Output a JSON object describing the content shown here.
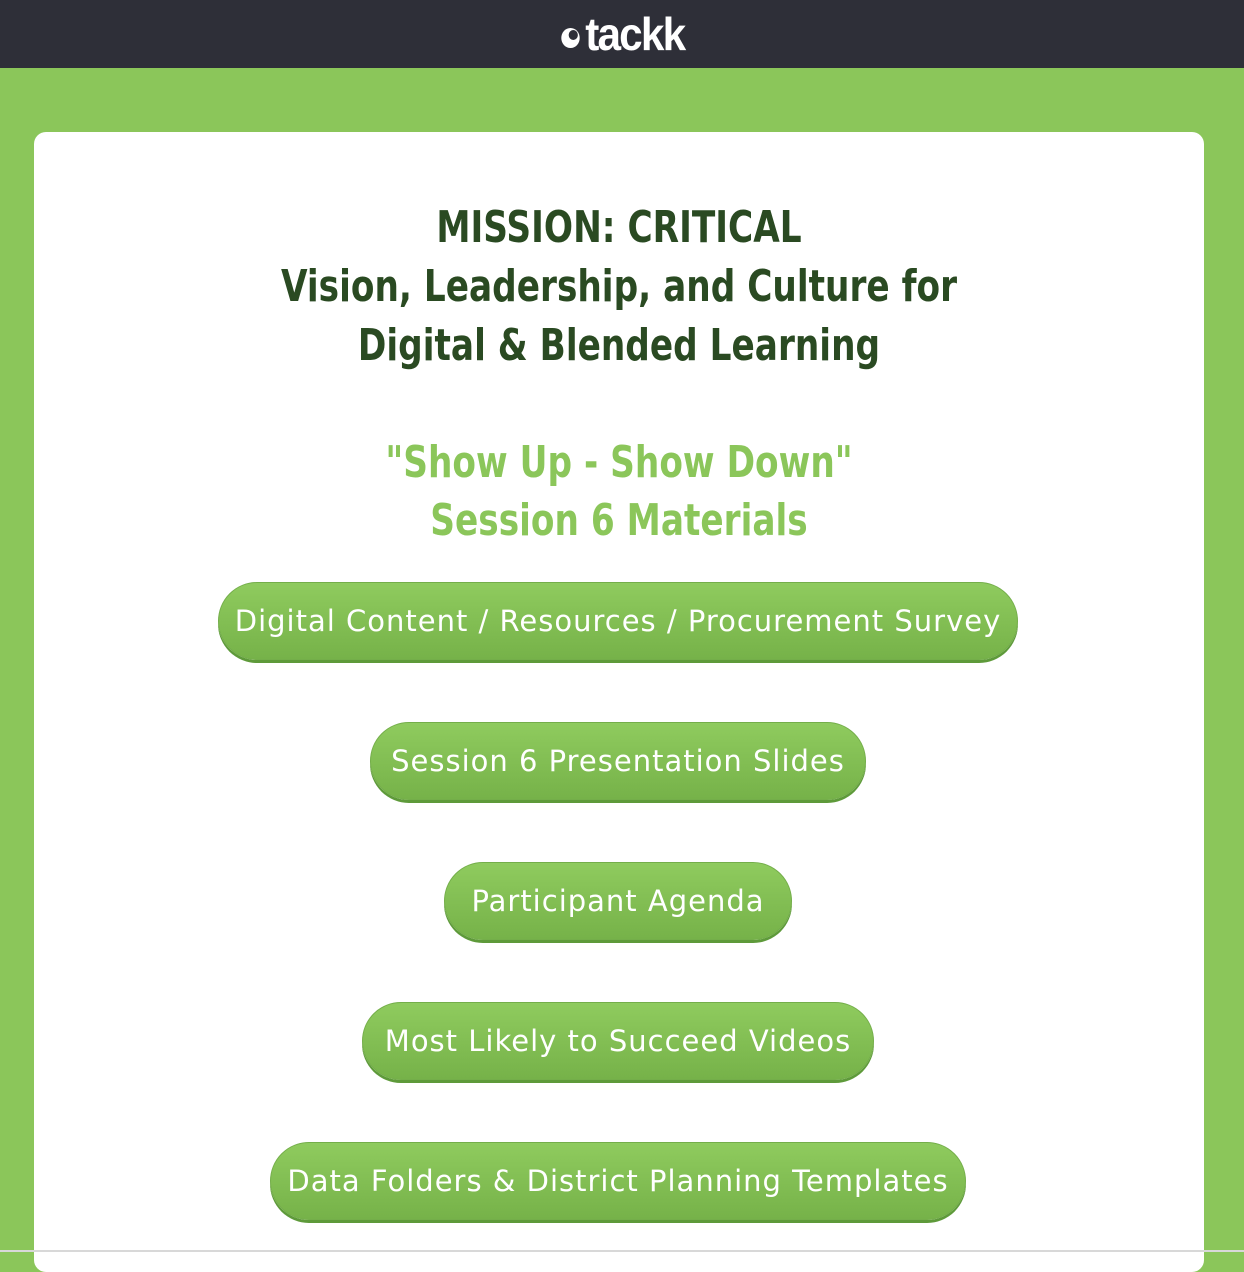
{
  "header": {
    "logo_text": "tackk"
  },
  "main": {
    "title_lines": [
      "MISSION: CRITICAL",
      "Vision, Leadership, and Culture for",
      "Digital & Blended Learning"
    ],
    "subtitle_lines": [
      "\"Show Up - Show Down\"",
      "Session 6 Materials"
    ],
    "buttons": [
      "Digital Content / Resources / Procurement Survey",
      "Session 6 Presentation Slides",
      "Participant Agenda",
      "Most Likely to Succeed Videos",
      "Data Folders & District Planning Templates"
    ]
  },
  "colors": {
    "background": "#8bc65a",
    "topbar": "#2e2f38",
    "title": "#2a4a22",
    "subtitle": "#8bc65a",
    "button": "#82bf54"
  }
}
